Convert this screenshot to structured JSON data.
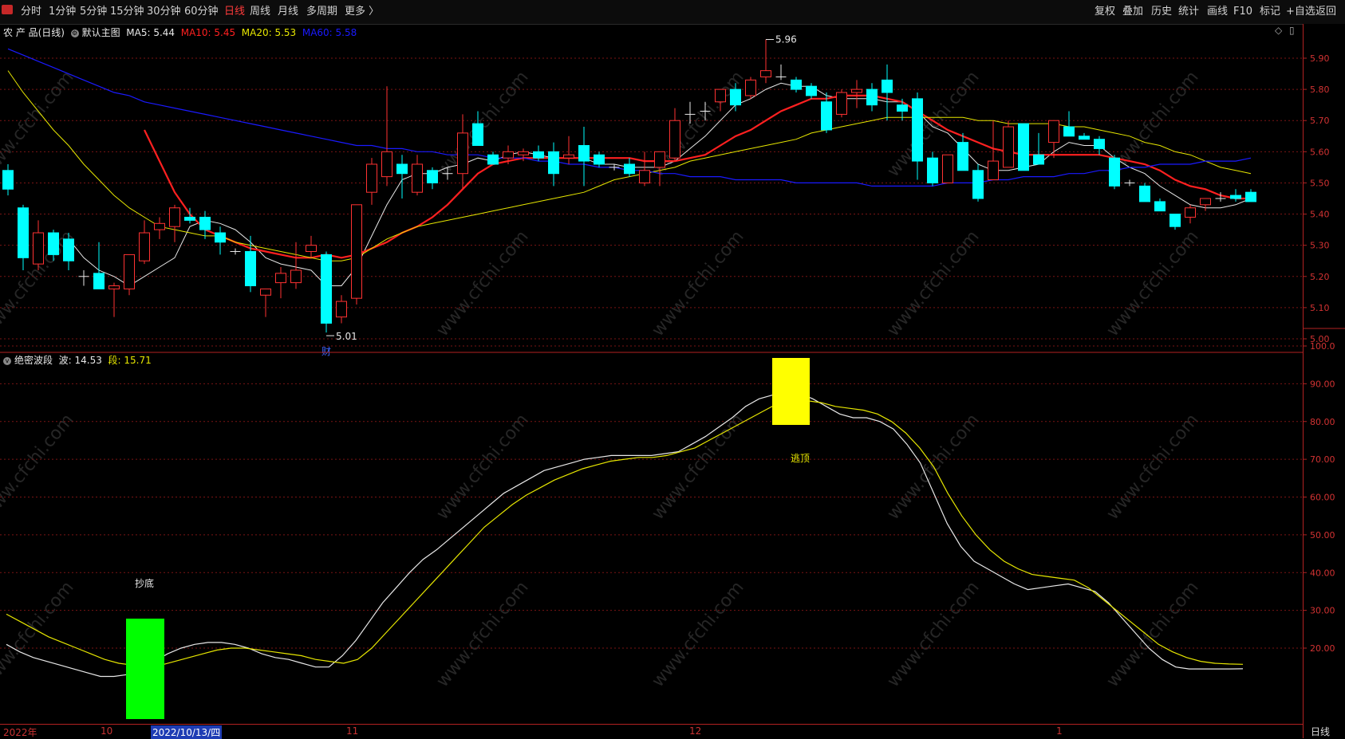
{
  "toolbar": {
    "periods": [
      "分时",
      "1分钟",
      "5分钟",
      "15分钟",
      "30分钟",
      "60分钟",
      "日线",
      "周线",
      "月线",
      "多周期",
      "更多 〉"
    ],
    "active_period": "日线",
    "actions": [
      "复权",
      "叠加",
      "历史",
      "统计",
      "画线",
      "F10",
      "标记",
      "+自选",
      "返回"
    ]
  },
  "main_panel": {
    "security": "农 产 品(日线)",
    "template": "默认主图",
    "ma5": {
      "label": "MA5: 5.44",
      "color": "#e8e8e8"
    },
    "ma10": {
      "label": "MA10: 5.45",
      "color": "#ff2020"
    },
    "ma20": {
      "label": "MA20: 5.53",
      "color": "#e6e600"
    },
    "ma60": {
      "label": "MA60: 5.58",
      "color": "#1a1aff"
    },
    "high_marker": "5.96",
    "low_marker": "5.01",
    "event_marker": "财",
    "y_ticks": [
      "5.90",
      "5.80",
      "5.70",
      "5.60",
      "5.50",
      "5.40",
      "5.30",
      "5.20",
      "5.10",
      "5.00"
    ]
  },
  "indicator_panel": {
    "name": "绝密波段",
    "wave_label": "波: 14.53",
    "segment_label": "段: 15.71",
    "y_ticks": [
      "100.0",
      "90.00",
      "80.00",
      "70.00",
      "60.00",
      "50.00",
      "40.00",
      "30.00",
      "20.00"
    ],
    "signal_buy": "抄底",
    "signal_sell": "逃顶"
  },
  "x_axis": {
    "labels": [
      "2022年",
      "10",
      "11",
      "12",
      "1"
    ],
    "cursor_date": "2022/10/13/四",
    "period": "日线"
  },
  "colors": {
    "up": "#ff3232",
    "down": "#00ffff",
    "grid": "#7a1414"
  },
  "chart_data": [
    {
      "type": "candlestick",
      "title": "农 产 品(日线)",
      "ylim": [
        4.98,
        5.96
      ],
      "candles_ohlc": [
        [
          5.54,
          5.56,
          5.46,
          5.48
        ],
        [
          5.42,
          5.43,
          5.22,
          5.26
        ],
        [
          5.24,
          5.38,
          5.22,
          5.34
        ],
        [
          5.34,
          5.35,
          5.25,
          5.27
        ],
        [
          5.32,
          5.34,
          5.22,
          5.25
        ],
        [
          5.2,
          5.22,
          5.17,
          5.2
        ],
        [
          5.21,
          5.31,
          5.16,
          5.16
        ],
        [
          5.16,
          5.18,
          5.07,
          5.17
        ],
        [
          5.16,
          5.27,
          5.14,
          5.27
        ],
        [
          5.25,
          5.38,
          5.24,
          5.34
        ],
        [
          5.35,
          5.39,
          5.32,
          5.37
        ],
        [
          5.36,
          5.43,
          5.31,
          5.42
        ],
        [
          5.39,
          5.42,
          5.37,
          5.38
        ],
        [
          5.39,
          5.41,
          5.32,
          5.35
        ],
        [
          5.34,
          5.36,
          5.27,
          5.31
        ],
        [
          5.28,
          5.29,
          5.27,
          5.28
        ],
        [
          5.28,
          5.33,
          5.15,
          5.17
        ],
        [
          5.14,
          5.16,
          5.07,
          5.16
        ],
        [
          5.18,
          5.23,
          5.13,
          5.21
        ],
        [
          5.18,
          5.31,
          5.16,
          5.22
        ],
        [
          5.28,
          5.33,
          5.26,
          5.3
        ],
        [
          5.27,
          5.28,
          5.02,
          5.05
        ],
        [
          5.07,
          5.14,
          5.05,
          5.12
        ],
        [
          5.13,
          5.43,
          5.11,
          5.43
        ],
        [
          5.47,
          5.58,
          5.43,
          5.56
        ],
        [
          5.52,
          5.81,
          5.49,
          5.6
        ],
        [
          5.56,
          5.59,
          5.45,
          5.53
        ],
        [
          5.47,
          5.59,
          5.46,
          5.56
        ],
        [
          5.54,
          5.55,
          5.48,
          5.5
        ],
        [
          5.53,
          5.55,
          5.51,
          5.53
        ],
        [
          5.53,
          5.72,
          5.48,
          5.66
        ],
        [
          5.69,
          5.73,
          5.62,
          5.62
        ],
        [
          5.59,
          5.6,
          5.56,
          5.56
        ],
        [
          5.58,
          5.62,
          5.56,
          5.6
        ],
        [
          5.59,
          5.61,
          5.57,
          5.6
        ],
        [
          5.6,
          5.62,
          5.57,
          5.58
        ],
        [
          5.6,
          5.63,
          5.49,
          5.53
        ],
        [
          5.58,
          5.65,
          5.56,
          5.59
        ],
        [
          5.62,
          5.68,
          5.49,
          5.57
        ],
        [
          5.59,
          5.6,
          5.55,
          5.56
        ],
        [
          5.55,
          5.56,
          5.54,
          5.55
        ],
        [
          5.56,
          5.58,
          5.52,
          5.53
        ],
        [
          5.5,
          5.6,
          5.49,
          5.54
        ],
        [
          5.55,
          5.6,
          5.49,
          5.6
        ],
        [
          5.58,
          5.74,
          5.57,
          5.7
        ],
        [
          5.72,
          5.76,
          5.69,
          5.72
        ],
        [
          5.73,
          5.76,
          5.7,
          5.73
        ],
        [
          5.76,
          5.8,
          5.73,
          5.8
        ],
        [
          5.8,
          5.82,
          5.73,
          5.75
        ],
        [
          5.78,
          5.84,
          5.77,
          5.83
        ],
        [
          5.84,
          5.96,
          5.82,
          5.86
        ],
        [
          5.84,
          5.88,
          5.83,
          5.84
        ],
        [
          5.83,
          5.84,
          5.79,
          5.8
        ],
        [
          5.81,
          5.82,
          5.77,
          5.78
        ],
        [
          5.76,
          5.79,
          5.66,
          5.67
        ],
        [
          5.72,
          5.8,
          5.71,
          5.79
        ],
        [
          5.79,
          5.83,
          5.74,
          5.8
        ],
        [
          5.8,
          5.82,
          5.73,
          5.75
        ],
        [
          5.83,
          5.88,
          5.7,
          5.79
        ],
        [
          5.75,
          5.77,
          5.7,
          5.73
        ],
        [
          5.77,
          5.79,
          5.51,
          5.57
        ],
        [
          5.58,
          5.6,
          5.49,
          5.5
        ],
        [
          5.5,
          5.59,
          5.5,
          5.59
        ],
        [
          5.63,
          5.66,
          5.54,
          5.54
        ],
        [
          5.54,
          5.56,
          5.44,
          5.45
        ],
        [
          5.51,
          5.7,
          5.51,
          5.57
        ],
        [
          5.55,
          5.7,
          5.55,
          5.68
        ],
        [
          5.69,
          5.69,
          5.54,
          5.54
        ],
        [
          5.59,
          5.66,
          5.56,
          5.56
        ],
        [
          5.63,
          5.7,
          5.58,
          5.7
        ],
        [
          5.68,
          5.73,
          5.65,
          5.65
        ],
        [
          5.65,
          5.66,
          5.64,
          5.64
        ],
        [
          5.64,
          5.65,
          5.59,
          5.61
        ],
        [
          5.58,
          5.59,
          5.48,
          5.49
        ],
        [
          5.5,
          5.51,
          5.49,
          5.5
        ],
        [
          5.49,
          5.5,
          5.44,
          5.44
        ],
        [
          5.44,
          5.45,
          5.41,
          5.41
        ],
        [
          5.4,
          5.4,
          5.35,
          5.36
        ],
        [
          5.39,
          5.43,
          5.37,
          5.42
        ],
        [
          5.43,
          5.45,
          5.41,
          5.45
        ],
        [
          5.45,
          5.47,
          5.44,
          5.45
        ],
        [
          5.46,
          5.48,
          5.44,
          5.45
        ],
        [
          5.47,
          5.48,
          5.44,
          5.44
        ]
      ],
      "series": [
        {
          "name": "MA5",
          "values": [
            null,
            null,
            null,
            null,
            5.32,
            5.26,
            5.22,
            5.2,
            5.17,
            5.2,
            5.23,
            5.26,
            5.36,
            5.38,
            5.37,
            5.35,
            5.31,
            5.26,
            5.24,
            5.23,
            5.22,
            5.17,
            5.17,
            5.23,
            5.33,
            5.43,
            5.51,
            5.53,
            5.53,
            5.55,
            5.56,
            5.58,
            5.57,
            5.59,
            5.6,
            5.59,
            5.58,
            5.58,
            5.58,
            5.56,
            5.56,
            5.55,
            5.55,
            5.55,
            5.57,
            5.61,
            5.65,
            5.7,
            5.75,
            5.77,
            5.8,
            5.82,
            5.81,
            5.81,
            5.78,
            5.77,
            5.77,
            5.77,
            5.76,
            5.76,
            5.73,
            5.68,
            5.66,
            5.61,
            5.56,
            5.54,
            5.54,
            5.55,
            5.56,
            5.6,
            5.63,
            5.62,
            5.62,
            5.58,
            5.55,
            5.53,
            5.49,
            5.46,
            5.43,
            5.42,
            5.42,
            5.43,
            5.45
          ]
        },
        {
          "name": "MA10",
          "values": [
            null,
            null,
            null,
            null,
            null,
            null,
            null,
            null,
            null,
            5.67,
            5.57,
            5.47,
            5.4,
            5.35,
            5.33,
            5.31,
            5.29,
            5.28,
            5.27,
            5.26,
            5.26,
            5.27,
            5.26,
            5.27,
            5.29,
            5.31,
            5.34,
            5.36,
            5.39,
            5.43,
            5.48,
            5.53,
            5.56,
            5.57,
            5.58,
            5.58,
            5.58,
            5.58,
            5.58,
            5.58,
            5.58,
            5.58,
            5.57,
            5.57,
            5.57,
            5.58,
            5.59,
            5.62,
            5.65,
            5.67,
            5.7,
            5.73,
            5.75,
            5.77,
            5.77,
            5.78,
            5.78,
            5.78,
            5.77,
            5.76,
            5.73,
            5.7,
            5.67,
            5.65,
            5.63,
            5.61,
            5.6,
            5.59,
            5.59,
            5.59,
            5.59,
            5.59,
            5.59,
            5.58,
            5.57,
            5.56,
            5.54,
            5.51,
            5.49,
            5.48,
            5.46,
            5.45,
            5.45
          ]
        },
        {
          "name": "MA20",
          "values": [
            5.86,
            5.79,
            5.73,
            5.67,
            5.62,
            5.56,
            5.51,
            5.46,
            5.42,
            5.39,
            5.36,
            5.35,
            5.34,
            5.33,
            5.33,
            5.31,
            5.3,
            5.29,
            5.28,
            5.27,
            5.26,
            5.25,
            5.25,
            5.26,
            5.29,
            5.32,
            5.34,
            5.36,
            5.37,
            5.38,
            5.39,
            5.4,
            5.41,
            5.42,
            5.43,
            5.44,
            5.45,
            5.46,
            5.47,
            5.49,
            5.51,
            5.52,
            5.53,
            5.54,
            5.55,
            5.57,
            5.58,
            5.59,
            5.6,
            5.61,
            5.62,
            5.63,
            5.64,
            5.66,
            5.67,
            5.68,
            5.69,
            5.7,
            5.71,
            5.71,
            5.71,
            5.71,
            5.71,
            5.71,
            5.7,
            5.7,
            5.69,
            5.69,
            5.69,
            5.69,
            5.68,
            5.68,
            5.67,
            5.66,
            5.65,
            5.63,
            5.62,
            5.6,
            5.59,
            5.57,
            5.55,
            5.54,
            5.53
          ]
        },
        {
          "name": "MA60",
          "values": [
            5.93,
            5.91,
            5.89,
            5.87,
            5.85,
            5.83,
            5.81,
            5.79,
            5.78,
            5.76,
            5.75,
            5.74,
            5.73,
            5.72,
            5.71,
            5.7,
            5.69,
            5.68,
            5.67,
            5.66,
            5.65,
            5.64,
            5.63,
            5.62,
            5.62,
            5.61,
            5.61,
            5.6,
            5.6,
            5.59,
            5.59,
            5.59,
            5.58,
            5.58,
            5.58,
            5.57,
            5.57,
            5.56,
            5.56,
            5.55,
            5.55,
            5.54,
            5.54,
            5.53,
            5.53,
            5.52,
            5.52,
            5.52,
            5.51,
            5.51,
            5.51,
            5.51,
            5.5,
            5.5,
            5.5,
            5.5,
            5.5,
            5.49,
            5.49,
            5.49,
            5.49,
            5.49,
            5.5,
            5.5,
            5.5,
            5.51,
            5.51,
            5.52,
            5.52,
            5.52,
            5.53,
            5.53,
            5.54,
            5.54,
            5.55,
            5.55,
            5.56,
            5.56,
            5.56,
            5.57,
            5.57,
            5.57,
            5.58
          ]
        }
      ]
    },
    {
      "type": "line",
      "title": "绝密波段",
      "ylim": [
        10,
        100
      ],
      "series": [
        {
          "name": "波",
          "values": [
            21,
            19,
            17.5,
            16.5,
            15.5,
            14.5,
            13.5,
            12.5,
            12.5,
            13,
            14.5,
            16.5,
            18.5,
            20,
            21,
            21.5,
            21.5,
            21,
            20,
            18.5,
            17.5,
            17,
            16,
            15,
            15,
            18,
            22,
            27,
            32,
            36,
            40,
            43.5,
            46,
            49,
            52,
            55,
            58,
            61,
            63,
            65,
            67,
            68,
            69,
            70,
            70.5,
            71,
            71,
            71,
            71,
            71.5,
            72,
            74,
            76,
            78.5,
            81,
            84,
            86,
            87,
            87.5,
            87.5,
            86,
            84,
            82,
            81,
            81,
            80,
            78,
            74,
            69,
            61,
            53,
            47,
            43,
            41,
            39,
            37,
            35.5,
            36,
            36.5,
            37,
            36,
            35,
            32,
            28,
            24,
            20,
            17,
            15,
            14.5,
            14.5,
            14.5,
            14.5,
            14.53
          ]
        },
        {
          "name": "段",
          "values": [
            29,
            27,
            25,
            23,
            21.5,
            20,
            18.5,
            17,
            16,
            15.5,
            15,
            15.5,
            16.5,
            17.5,
            18.5,
            19.5,
            20,
            20,
            19.5,
            19,
            18.5,
            18,
            17,
            16.5,
            16,
            17,
            20,
            24,
            28,
            32,
            36,
            40,
            44,
            48,
            52,
            55,
            58,
            60.5,
            62.5,
            64.5,
            66,
            67.5,
            68.5,
            69.5,
            70,
            70.5,
            70.5,
            71,
            72,
            73,
            75,
            77,
            79,
            81,
            83,
            85,
            85.5,
            85.5,
            85,
            84,
            83.5,
            83,
            82,
            80,
            77,
            73,
            68,
            61,
            55,
            50,
            46,
            43,
            41,
            39.5,
            39,
            38.5,
            38,
            36,
            33,
            30,
            27,
            24,
            21,
            19,
            17.5,
            16.5,
            16,
            15.8,
            15.71
          ]
        }
      ]
    }
  ]
}
